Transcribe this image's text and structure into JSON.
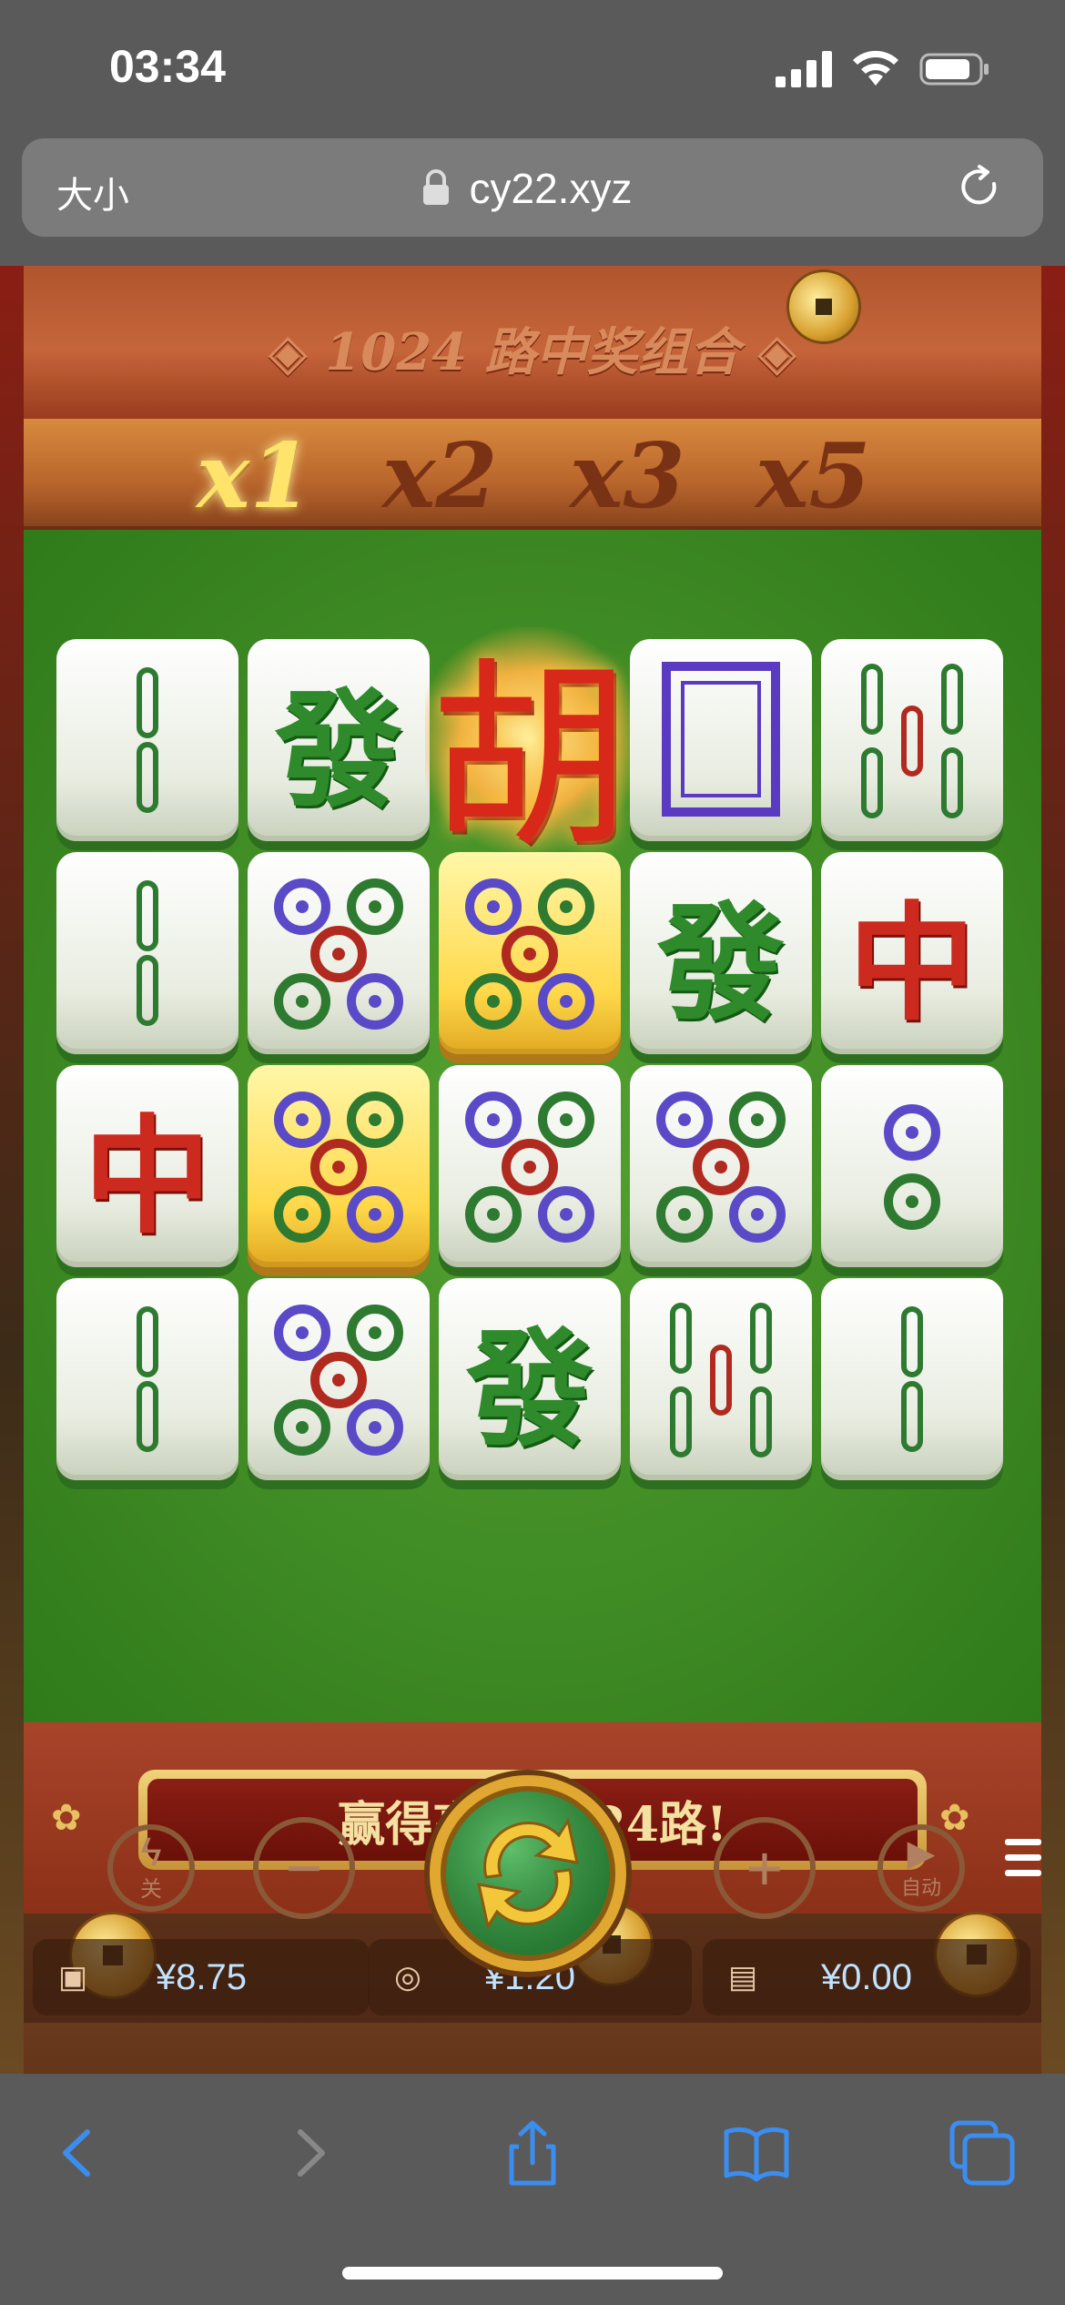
{
  "status_bar": {
    "time": "03:34"
  },
  "url_bar": {
    "text_size_label": "大小",
    "url": "cy22.xyz"
  },
  "game": {
    "banner_title": "◈ 1024 路中奖组合 ◈",
    "multipliers": [
      {
        "label": "x1",
        "active": true
      },
      {
        "label": "x2",
        "active": false
      },
      {
        "label": "x3",
        "active": false
      },
      {
        "label": "x5",
        "active": false
      }
    ],
    "win_message": "赢得高达1024路!",
    "balance": "¥8.75",
    "bet": "¥1.20",
    "win": "¥0.00",
    "turbo_label": "关",
    "auto_label": "自动",
    "grid": [
      [
        "2-bamboo",
        "fa",
        "hu",
        "white-dragon",
        "5-bamboo"
      ],
      [
        "2-bamboo",
        "5-dots",
        "5-dots-gold",
        "fa",
        "zhong"
      ],
      [
        "zhong",
        "5-dots-gold",
        "5-dots",
        "5-dots",
        "2-dots"
      ],
      [
        "2-bamboo",
        "5-dots",
        "fa",
        "5-bamboo",
        "2-bamboo"
      ]
    ],
    "tile_text": {
      "fa": "發",
      "zhong": "中",
      "hu": "胡"
    }
  }
}
